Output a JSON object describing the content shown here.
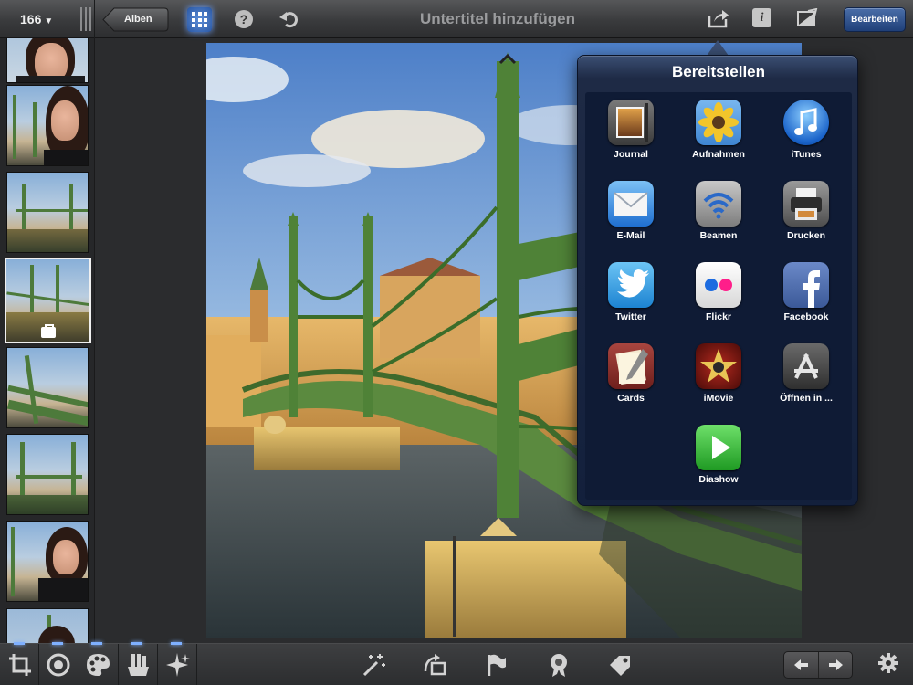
{
  "topbar": {
    "photo_count": "166",
    "albums_label": "Alben",
    "help_glyph": "?",
    "subtitle_placeholder": "Untertitel hinzufügen",
    "info_glyph": "i",
    "edit_label": "Bearbeiten"
  },
  "share_popover": {
    "title": "Bereitstellen",
    "items": [
      {
        "label": "Journal",
        "icon": "journal-icon"
      },
      {
        "label": "Aufnahmen",
        "icon": "camera-roll-icon"
      },
      {
        "label": "iTunes",
        "icon": "itunes-icon"
      },
      {
        "label": "E-Mail",
        "icon": "mail-icon"
      },
      {
        "label": "Beamen",
        "icon": "beam-icon"
      },
      {
        "label": "Drucken",
        "icon": "print-icon"
      },
      {
        "label": "Twitter",
        "icon": "twitter-icon"
      },
      {
        "label": "Flickr",
        "icon": "flickr-icon"
      },
      {
        "label": "Facebook",
        "icon": "facebook-icon"
      },
      {
        "label": "Cards",
        "icon": "cards-icon"
      },
      {
        "label": "iMovie",
        "icon": "imovie-icon"
      },
      {
        "label": "Öffnen in ...",
        "icon": "app-store-icon"
      },
      {
        "label": "Diashow",
        "icon": "slideshow-icon"
      }
    ]
  },
  "thumbnails": [
    {
      "subject": "portrait"
    },
    {
      "subject": "portrait-with-bridge"
    },
    {
      "subject": "bridge"
    },
    {
      "subject": "bridge",
      "selected": true
    },
    {
      "subject": "bridge-detail"
    },
    {
      "subject": "bridge"
    },
    {
      "subject": "portrait-with-bridge"
    },
    {
      "subject": "portrait"
    }
  ],
  "bottom_tools": {
    "left": [
      "crop-icon",
      "exposure-icon",
      "color-palette-icon",
      "brushes-icon",
      "effects-icon"
    ],
    "center": [
      "auto-enhance-icon",
      "rotate-icon",
      "flag-icon",
      "favorite-icon",
      "tag-icon"
    ],
    "nav": [
      "previous-arrow-icon",
      "next-arrow-icon"
    ],
    "settings": "gear-icon"
  },
  "colors": {
    "toolbar": "#3a3b3d",
    "edit_button": "#2b4f8a",
    "popover": "#13203c",
    "active_tool_indicator": "#7fb0ff"
  }
}
